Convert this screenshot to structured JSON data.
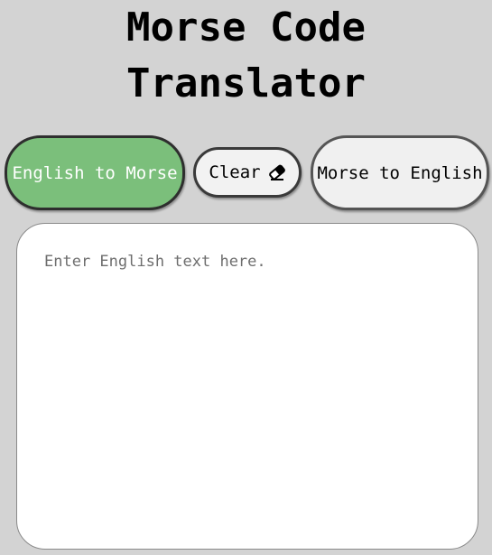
{
  "title": "Morse Code Translator",
  "buttons": {
    "english_to_morse": "English to Morse",
    "clear": "Clear",
    "morse_to_english": "Morse to English"
  },
  "input": {
    "placeholder": "Enter English text here.",
    "value": ""
  },
  "icons": {
    "clear": "eraser-icon"
  },
  "colors": {
    "background": "#d3d3d3",
    "active_button": "#7bbf7b",
    "inactive_button": "#f0f0f0"
  }
}
